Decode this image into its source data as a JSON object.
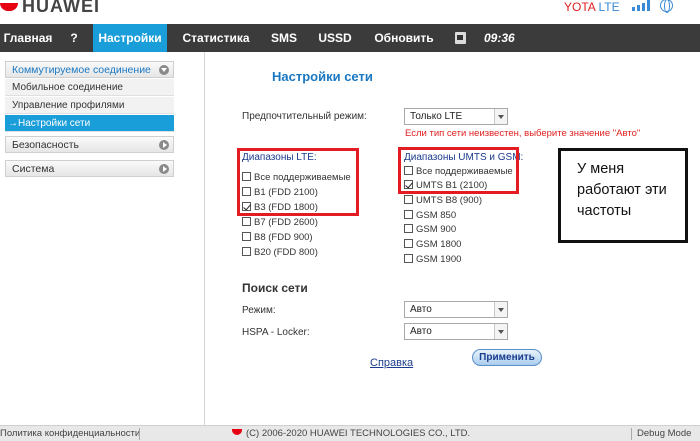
{
  "header": {
    "brand": "HUAWEI",
    "operator_name": "YOTA",
    "network_type": "LTE",
    "signal_bars": 4,
    "icons": [
      "signal-bars-icon",
      "globe-icon",
      "sim-card-icon"
    ],
    "brand_color": "#e60012"
  },
  "nav": {
    "items": [
      {
        "label": "Главная"
      },
      {
        "label": "?"
      },
      {
        "label": "Настройки",
        "active": true
      },
      {
        "label": "Статистика"
      },
      {
        "label": "SMS"
      },
      {
        "label": "USSD"
      },
      {
        "label": "Обновить"
      }
    ],
    "time": "09:36",
    "active_color": "#1a9ed9"
  },
  "sidebar": {
    "groups": [
      {
        "label": "Коммутируемое соединение",
        "expanded": true,
        "items": [
          {
            "label": "Мобильное соединение"
          },
          {
            "label": "Управление профилями"
          },
          {
            "label": "→Настройки сети",
            "active": true
          }
        ]
      },
      {
        "label": "Безопасность",
        "expanded": false
      },
      {
        "label": "Система",
        "expanded": false
      }
    ]
  },
  "main": {
    "title": "Настройки сети",
    "preferred_mode": {
      "label": "Предпочтительный режим:",
      "value": "Только LTE"
    },
    "warning": "Если тип сети неизвестен, выберите значение \"Авто\"",
    "lte_bands": {
      "title": "Диапазоны LTE:",
      "options": [
        {
          "label": "Все поддерживаемые",
          "checked": false
        },
        {
          "label": "B1 (FDD 2100)",
          "checked": false
        },
        {
          "label": "B3 (FDD 1800)",
          "checked": true
        },
        {
          "label": "B7 (FDD 2600)",
          "checked": false
        },
        {
          "label": "B8 (FDD 900)",
          "checked": false
        },
        {
          "label": "B20 (FDD 800)",
          "checked": false
        }
      ]
    },
    "umts_bands": {
      "title": "Диапазоны UMTS и GSM:",
      "options": [
        {
          "label": "Все поддерживаемые",
          "checked": false
        },
        {
          "label": "UMTS B1 (2100)",
          "checked": true
        },
        {
          "label": "UMTS B8 (900)",
          "checked": false
        },
        {
          "label": "GSM 850",
          "checked": false
        },
        {
          "label": "GSM 900",
          "checked": false
        },
        {
          "label": "GSM 1800",
          "checked": false
        },
        {
          "label": "GSM 1900",
          "checked": false
        }
      ]
    },
    "network_search": {
      "title": "Поиск сети",
      "mode_label": "Режим:",
      "mode_value": "Авто",
      "hspa_label": "HSPA - Locker:",
      "hspa_value": "Авто"
    },
    "help_link": "Справка",
    "apply_button": "Применить"
  },
  "annotation": {
    "text": "У меня работают эти частоты",
    "highlight_color": "#e31b23"
  },
  "footer": {
    "privacy": "Политика конфиденциальности",
    "copyright": "(C) 2006-2020 HUAWEI TECHNOLOGIES CO., LTD.",
    "debug": "Debug Mode"
  }
}
